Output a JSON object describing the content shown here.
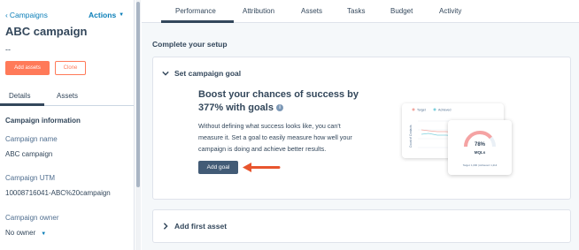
{
  "sidebar": {
    "back_label": "Campaigns",
    "actions_label": "Actions",
    "campaign_title": "ABC campaign",
    "dash": "--",
    "add_assets_label": "Add assets",
    "clone_label": "Clone",
    "tabs": [
      {
        "label": "Details",
        "active": true
      },
      {
        "label": "Assets",
        "active": false
      }
    ],
    "section_title": "Campaign information",
    "fields": {
      "name_label": "Campaign name",
      "name_value": "ABC campaign",
      "utm_label": "Campaign UTM",
      "utm_value": "10008716041-ABC%20campaign",
      "owner_label": "Campaign owner",
      "owner_value": "No owner"
    }
  },
  "topnav": {
    "items": [
      {
        "label": "Performance",
        "active": true
      },
      {
        "label": "Attribution",
        "active": false
      },
      {
        "label": "Assets",
        "active": false
      },
      {
        "label": "Tasks",
        "active": false
      },
      {
        "label": "Budget",
        "active": false
      },
      {
        "label": "Activity",
        "active": false
      }
    ]
  },
  "setup": {
    "title": "Complete your setup",
    "goal_card": {
      "title": "Set campaign goal",
      "headline": "Boost your chances of success by 377% with goals",
      "description": "Without defining what success looks like, you can't measure it. Set a goal to easily measure how well your campaign is doing and achieve better results.",
      "button_label": "Add goal",
      "illustration": {
        "legend_target": "Target",
        "legend_achieved": "Achieved",
        "y_axis_label": "Count of Contacts",
        "gauge_percent": "78%",
        "gauge_label": "MQLs",
        "gauge_fill": 0.78,
        "gauge_footer": "Target: 1,000 | Achieved: 1,214"
      }
    },
    "asset_card": {
      "title": "Add first asset"
    }
  },
  "colors": {
    "accent_orange": "#ff7a59",
    "link_blue": "#0a7eb8",
    "button_dark": "#425b76",
    "arrow_red": "#e8552e",
    "text_primary": "#33475b"
  }
}
